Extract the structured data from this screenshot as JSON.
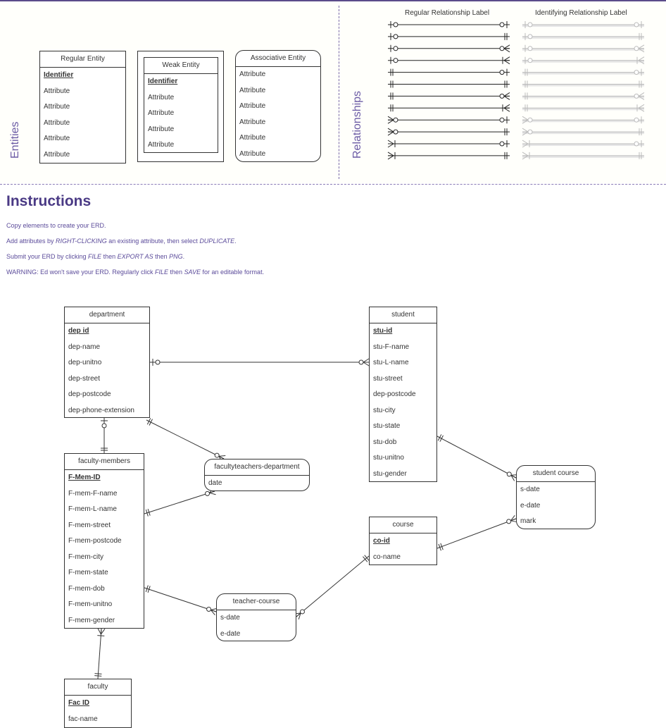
{
  "legend": {
    "entities_label": "Entities",
    "relationships_label": "Relationships",
    "regular_entity": {
      "title": "Regular Entity",
      "identifier": "Identifier",
      "attributes": [
        "Attribute",
        "Attribute",
        "Attribute",
        "Attribute",
        "Attribute"
      ]
    },
    "weak_entity": {
      "title": "Weak Entity",
      "identifier": "Identifier",
      "attributes": [
        "Attribute",
        "Attribute",
        "Attribute",
        "Attribute"
      ]
    },
    "associative_entity": {
      "title": "Associative Entity",
      "attributes": [
        "Attribute",
        "Attribute",
        "Attribute",
        "Attribute",
        "Attribute",
        "Attribute"
      ]
    },
    "regular_relationship_label": "Regular Relationship Label",
    "identifying_relationship_label": "Identifying Relationship Label",
    "relationship_rows": [
      {
        "left": "zero-or-one",
        "right": "zero-or-one"
      },
      {
        "left": "zero-or-one",
        "right": "one-and-only-one"
      },
      {
        "left": "zero-or-one",
        "right": "zero-or-many"
      },
      {
        "left": "zero-or-one",
        "right": "one-or-many"
      },
      {
        "left": "one-and-only-one",
        "right": "zero-or-one"
      },
      {
        "left": "one-and-only-one",
        "right": "one-and-only-one"
      },
      {
        "left": "one-and-only-one",
        "right": "zero-or-many"
      },
      {
        "left": "one-and-only-one",
        "right": "one-or-many"
      },
      {
        "left": "zero-or-many",
        "right": "zero-or-one"
      },
      {
        "left": "zero-or-many",
        "right": "one-and-only-one"
      },
      {
        "left": "one-or-many",
        "right": "zero-or-one"
      },
      {
        "left": "one-or-many",
        "right": "one-and-only-one"
      }
    ]
  },
  "instructions": {
    "title": "Instructions",
    "lines": [
      [
        {
          "t": "Copy elements to create your ERD."
        }
      ],
      [
        {
          "t": "Add attributes by "
        },
        {
          "t": "RIGHT-CLICKING",
          "i": true
        },
        {
          "t": " an existing attribute, then select "
        },
        {
          "t": "DUPLICATE",
          "i": true
        },
        {
          "t": "."
        }
      ],
      [
        {
          "t": "Submit your ERD by clicking "
        },
        {
          "t": "FILE",
          "i": true
        },
        {
          "t": " then "
        },
        {
          "t": "EXPORT AS",
          "i": true
        },
        {
          "t": " then "
        },
        {
          "t": "PNG",
          "i": true
        },
        {
          "t": "."
        }
      ],
      [
        {
          "t": "WARNING: Ed won't save your ERD. Regularly click "
        },
        {
          "t": "FILE",
          "i": true
        },
        {
          "t": " then "
        },
        {
          "t": "SAVE",
          "i": true
        },
        {
          "t": " for an editable format."
        }
      ]
    ]
  },
  "erd": {
    "entities": {
      "department": {
        "title": "department",
        "identifier": "dep id",
        "attributes": [
          "dep-name",
          "dep-unitno",
          "dep-street",
          "dep-postcode",
          "dep-phone-extension"
        ]
      },
      "student": {
        "title": "student",
        "identifier": "stu-id",
        "attributes": [
          "stu-F-name",
          "stu-L-name",
          "stu-street",
          "dep-postcode",
          "stu-city",
          "stu-state",
          "stu-dob",
          "stu-unitno",
          "stu-gender"
        ]
      },
      "faculty_members": {
        "title": "faculty-members",
        "identifier": "F-Mem-ID",
        "attributes": [
          "F-mem-F-name",
          "F-mem-L-name",
          "F-mem-street",
          "F-mem-postcode",
          "F-mem-city",
          "F-mem-state",
          "F-mem-dob",
          "F-mem-unitno",
          "F-mem-gender"
        ]
      },
      "course": {
        "title": "course",
        "identifier": "co-id",
        "attributes": [
          "co-name"
        ]
      },
      "faculty": {
        "title": "faculty",
        "identifier": "Fac ID",
        "attributes": [
          "fac-name"
        ]
      }
    },
    "associative": {
      "facultyteachers_department": {
        "title": "facultyteachers-department",
        "attributes": [
          "date"
        ]
      },
      "student_course": {
        "title": "student course",
        "attributes": [
          "s-date",
          "e-date",
          "mark"
        ]
      },
      "teacher_course": {
        "title": "teacher-course",
        "attributes": [
          "s-date",
          "e-date"
        ]
      }
    },
    "relationships": [
      {
        "from": "department",
        "to": "student",
        "from_card": "zero-or-one",
        "to_card": "zero-or-many"
      },
      {
        "from": "department",
        "to": "faculty-members",
        "from_card": "zero-or-one",
        "to_card": "one-and-only-one"
      },
      {
        "from": "department",
        "to": "facultyteachers-department",
        "from_card": "one-and-only-one",
        "to_card": "zero-or-many"
      },
      {
        "from": "faculty-members",
        "to": "facultyteachers-department",
        "from_card": "one-and-only-one",
        "to_card": "zero-or-many"
      },
      {
        "from": "faculty-members",
        "to": "teacher-course",
        "from_card": "one-and-only-one",
        "to_card": "zero-or-many"
      },
      {
        "from": "course",
        "to": "teacher-course",
        "from_card": "one-and-only-one",
        "to_card": "zero-or-many"
      },
      {
        "from": "student",
        "to": "student course",
        "from_card": "one-and-only-one",
        "to_card": "zero-or-many"
      },
      {
        "from": "course",
        "to": "student course",
        "from_card": "one-and-only-one",
        "to_card": "zero-or-many"
      },
      {
        "from": "faculty-members",
        "to": "faculty",
        "from_card": "one-or-many",
        "to_card": "one-and-only-one"
      }
    ]
  }
}
